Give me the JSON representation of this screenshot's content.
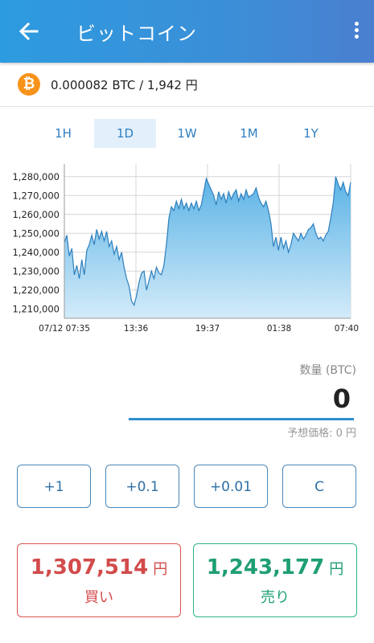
{
  "app_bar": {
    "title": "ビットコイン",
    "back_icon": "arrow-left-icon",
    "menu_icon": "more-vertical-icon"
  },
  "holding": {
    "icon": "bitcoin-icon",
    "logo_glyph": "₿",
    "text": "0.000082 BTC / 1,942 円"
  },
  "period_tabs": [
    {
      "label": "1H",
      "active": false
    },
    {
      "label": "1D",
      "active": true
    },
    {
      "label": "1W",
      "active": false
    },
    {
      "label": "1M",
      "active": false
    },
    {
      "label": "1Y",
      "active": false
    }
  ],
  "chart_data": {
    "type": "area",
    "title": "",
    "xlabel": "",
    "ylabel": "",
    "ylim": [
      1205000,
      1285000
    ],
    "y_ticks": [
      "1,280,000",
      "1,270,000",
      "1,260,000",
      "1,250,000",
      "1,240,000",
      "1,230,000",
      "1,220,000",
      "1,210,000"
    ],
    "y_tick_values": [
      1280000,
      1270000,
      1260000,
      1250000,
      1240000,
      1230000,
      1220000,
      1210000
    ],
    "x_tick_labels": [
      "07/12 07:35",
      "13:36",
      "19:37",
      "01:38",
      "07:40"
    ],
    "grid": true,
    "series": [
      {
        "values": [
          1245000,
          1249000,
          1238000,
          1242000,
          1228000,
          1233000,
          1226000,
          1236000,
          1228000,
          1241000,
          1244000,
          1249000,
          1244000,
          1252000,
          1247000,
          1251000,
          1246000,
          1251000,
          1243000,
          1246000,
          1239000,
          1243000,
          1236000,
          1240000,
          1232000,
          1226000,
          1222000,
          1214000,
          1212000,
          1217000,
          1224000,
          1229000,
          1230000,
          1220000,
          1225000,
          1230000,
          1226000,
          1232000,
          1229000,
          1228000,
          1233000,
          1244000,
          1258000,
          1264000,
          1262000,
          1267000,
          1263000,
          1268000,
          1263000,
          1266000,
          1262000,
          1266000,
          1263000,
          1267000,
          1262000,
          1265000,
          1272000,
          1279000,
          1276000,
          1273000,
          1270000,
          1265000,
          1272000,
          1268000,
          1271000,
          1266000,
          1272000,
          1268000,
          1271000,
          1273000,
          1267000,
          1271000,
          1268000,
          1273000,
          1269000,
          1270000,
          1271000,
          1274000,
          1269000,
          1266000,
          1264000,
          1267000,
          1262000,
          1255000,
          1243000,
          1248000,
          1241000,
          1248000,
          1242000,
          1246000,
          1240000,
          1244000,
          1250000,
          1248000,
          1246000,
          1250000,
          1247000,
          1249000,
          1252000,
          1253000,
          1255000,
          1250000,
          1247000,
          1248000,
          1246000,
          1249000,
          1251000,
          1258000,
          1266000,
          1280000,
          1276000,
          1273000,
          1277000,
          1272000,
          1270000,
          1277000
        ]
      }
    ],
    "colors": {
      "line": "#3a9ad9",
      "fill_top": "#5bb3e6",
      "fill_bottom": "#d3ebf9"
    }
  },
  "quantity": {
    "label": "数量 (BTC)",
    "value": "0",
    "estimated_price": "予想価格: 0 円"
  },
  "step_buttons": [
    "+1",
    "+0.1",
    "+0.01",
    "C"
  ],
  "buy": {
    "price": "1,307,514",
    "currency": "円",
    "label": "買い",
    "color": "#d24b4b"
  },
  "sell": {
    "price": "1,243,177",
    "currency": "円",
    "label": "売り",
    "color": "#1e9e74"
  }
}
